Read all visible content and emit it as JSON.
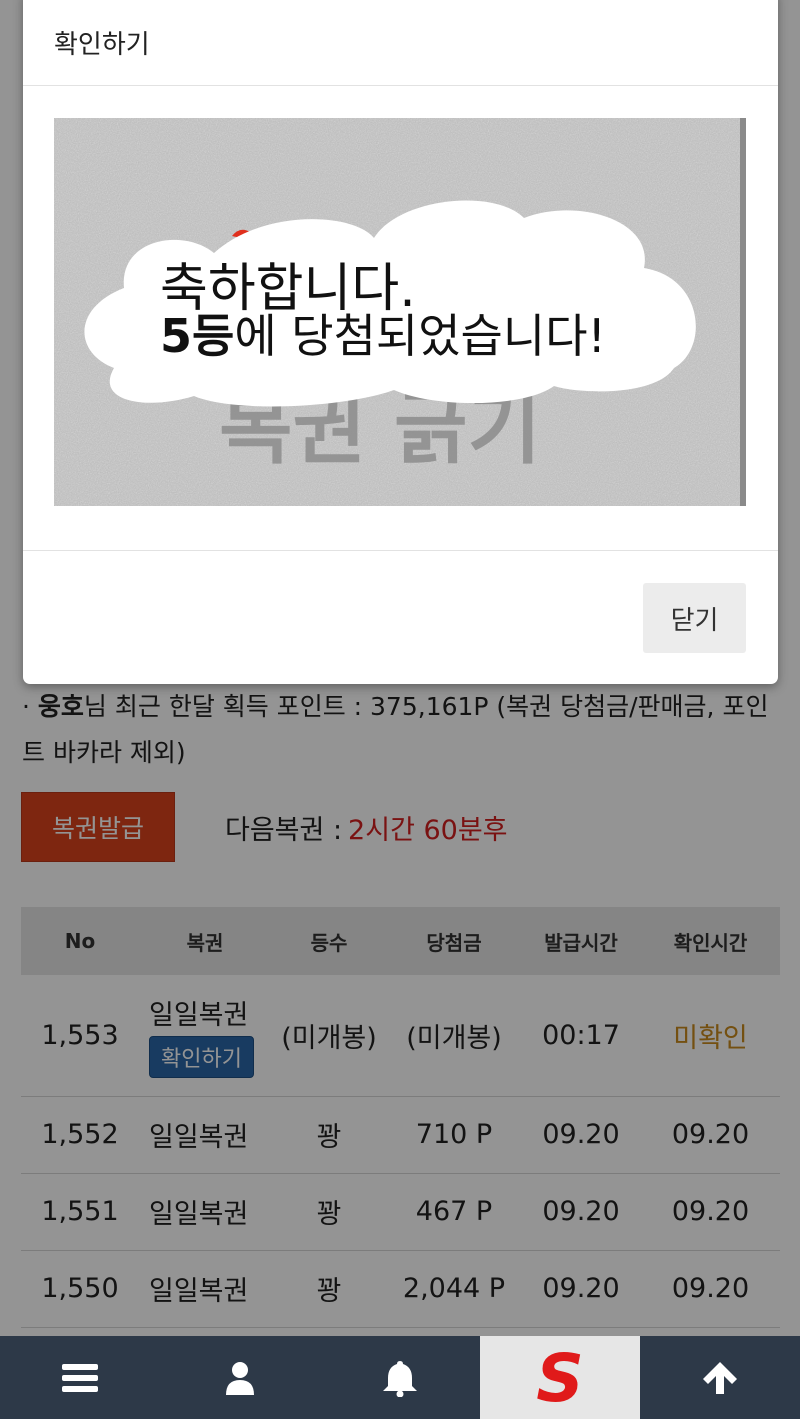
{
  "points_info": {
    "bullet": "·",
    "user_name": "웅호",
    "text": "님 최근 한달 획득 포인트 : 375,161P (복권 당첨금/판매금, 포인트 바카라 제외)"
  },
  "issue": {
    "button_label": "복권발급",
    "next_label": "다음복권 :",
    "next_value": "2시간 60분후"
  },
  "table": {
    "headers": [
      "No",
      "복권",
      "등수",
      "당첨금",
      "발급시간",
      "확인시간"
    ],
    "rows": [
      {
        "no": "1,553",
        "lottery": "일일복권",
        "action": "확인하기",
        "rank": "(미개봉)",
        "prize": "(미개봉)",
        "issued": "00:17",
        "checked": "미확인"
      },
      {
        "no": "1,552",
        "lottery": "일일복권",
        "rank": "꽝",
        "prize": "710 P",
        "issued": "09.20",
        "checked": "09.20"
      },
      {
        "no": "1,551",
        "lottery": "일일복권",
        "rank": "꽝",
        "prize": "467 P",
        "issued": "09.20",
        "checked": "09.20"
      },
      {
        "no": "1,550",
        "lottery": "일일복권",
        "rank": "꽝",
        "prize": "2,044 P",
        "issued": "09.20",
        "checked": "09.20"
      }
    ]
  },
  "modal": {
    "title": "확인하기",
    "scratch_bg_text": "복권 긁기",
    "message_line1": "축하합니다.",
    "message_line2_bold": "5등",
    "message_line2_rest": "에 당첨되었습니다!",
    "close_label": "닫기"
  },
  "bottom_nav": {
    "items": [
      "menu-icon",
      "user-icon",
      "bell-icon",
      "site-logo",
      "arrow-up-icon"
    ],
    "logo_letter": "S"
  },
  "colors": {
    "accent_red": "#d9431d",
    "countdown_red": "#d22020",
    "unconfirmed": "#c98a1e",
    "chip_blue": "#2a67a8",
    "nav_bg": "#2d3948"
  }
}
